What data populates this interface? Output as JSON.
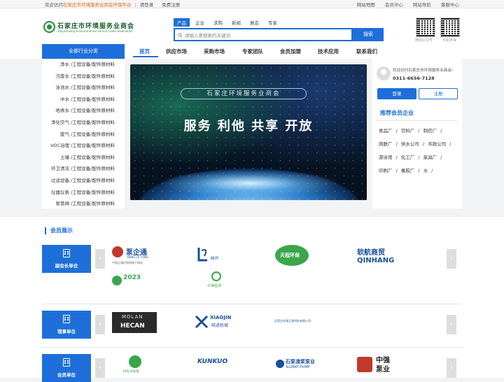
{
  "topbar": {
    "welcome": "欢迎访问",
    "site": "石家庄市环境服务业商会环保平台",
    "login": "请登录",
    "register": "免费注册",
    "links": [
      "网站地图",
      "会员中心",
      "网站导航",
      "客服中心"
    ]
  },
  "logo": {
    "cn": "石家庄市环境服务业商会",
    "en": "Shijiazhuang Environmental Service trade association"
  },
  "search": {
    "tabs": [
      "产品",
      "企业",
      "求购",
      "新闻",
      "展会",
      "专家"
    ],
    "active_tab": "产品",
    "placeholder": "请输入要搜索的关键词",
    "button": "搜索"
  },
  "qr": {
    "left_label": "微信公众号",
    "right_label": "手机环保"
  },
  "category_button": "全部行业分类",
  "nav": [
    "首页",
    "供应市场",
    "采购市场",
    "专家团队",
    "会员加盟",
    "技术应用",
    "联系我们"
  ],
  "categories": [
    "净水 /工程设备/配件原材料",
    "污废水 /工程设备/配件原材料",
    "泳池水 /工程设备/配件原材料",
    "中水 /工程设备/配件原材料",
    "地表水 /工程设备/配件原材料",
    "净化空气 /工程设备/配件原材料",
    "废气 /工程设备/配件原材料",
    "VOC治理 /工程设备/配件原材料",
    "土壤 /工程设备/配件原材料",
    "环卫清洁 /工程设备/配件原材料",
    "过滤设备 /工程设备/配件原材料",
    "仪器仪表 /工程设备/配件原材料",
    "泵管阀 /工程设备/配件原材料"
  ],
  "banner": {
    "title": "石家庄环境服务业商会",
    "slogan": "服务  利他  共享  开放"
  },
  "user": {
    "welcome": "欢迎访问石家庄市环境服务业商会!",
    "phone": "0311-6656-7128",
    "login": "登录",
    "register": "注册"
  },
  "recommend": {
    "title": "推荐会员企业",
    "tags": [
      "食品厂",
      "饮料厂",
      "制药厂",
      "肉联厂",
      "供水公司",
      "市政公司",
      "游泳馆",
      "化工厂",
      "家具厂",
      "印刷厂",
      "橡胶厂",
      "水"
    ]
  },
  "members": {
    "title": "会员展示",
    "groups": [
      {
        "label": "副会长单位",
        "logos": [
          "泵企通",
          "BENG QI TONG",
          "中版企通环保网旗下网站",
          "陆升",
          "天程环保",
          "软航商贸",
          "QINHANG",
          "2023",
          "众净检测"
        ]
      },
      {
        "label": "理事单位",
        "logos": [
          "MOLAN",
          "HECAN",
          "XIAOJIN",
          "晓进机械",
          "石家庄市清之源科技有限公司"
        ]
      },
      {
        "label": "会员单位",
        "logos": [
          "绿岛水处理",
          "KUNKUO",
          "石泵渣浆泵业",
          "SLURRY PUMP",
          "中强",
          "泵业"
        ]
      }
    ]
  },
  "colors": {
    "primary": "#1e6fd9",
    "accent": "#e86a10",
    "logo_green": "#2e8b3e"
  }
}
